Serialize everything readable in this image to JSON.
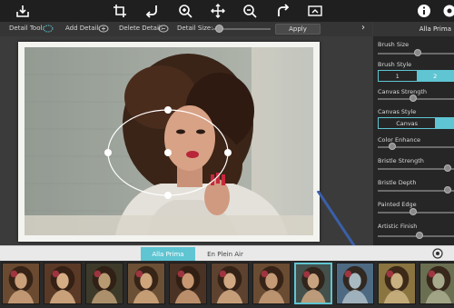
{
  "toolbar": {
    "icons": [
      "save-icon",
      "crop-icon",
      "undo-icon",
      "zoom-in-icon",
      "move-icon",
      "zoom-out-icon",
      "redo-icon",
      "fit-screen-icon",
      "info-icon",
      "settings-icon"
    ]
  },
  "detail_bar": {
    "detail_tool_label": "Detail Tool:",
    "add_detail_label": "Add Detail:",
    "delete_detail_label": "Delete Detail:",
    "detail_size_label": "Detail Size:",
    "detail_size_value": 0.05,
    "apply_label": "Apply",
    "next_arrow": "›"
  },
  "panel": {
    "title": "Alla Prima",
    "brush_size_label": "Brush Size",
    "brush_size_value": 0.52,
    "brush_style_label": "Brush Style",
    "brush_style_options": [
      "1",
      "2"
    ],
    "brush_style_selected": "2",
    "canvas_strength_label": "Canvas Strength",
    "canvas_strength_value": 0.45,
    "canvas_style_label": "Canvas Style",
    "canvas_style_option": "Canvas",
    "color_enhance_label": "Color Enhance",
    "color_enhance_value": 0.15,
    "bristle_strength_label": "Bristle Strength",
    "bristle_strength_value": 0.95,
    "bristle_depth_label": "Bristle Depth",
    "bristle_depth_value": 0.95,
    "painted_edge_label": "Painted Edge",
    "painted_edge_value": 0.45,
    "artistic_finish_label": "Artistic Finish",
    "artistic_finish_value": 0.55
  },
  "tabs": {
    "alla_prima": "Alla Prima",
    "en_plein_air": "En Plein Air"
  },
  "colors": {
    "accent": "#5fc5d2",
    "toolbar_bg": "#1f1f1f",
    "panel_bg": "#262626"
  }
}
